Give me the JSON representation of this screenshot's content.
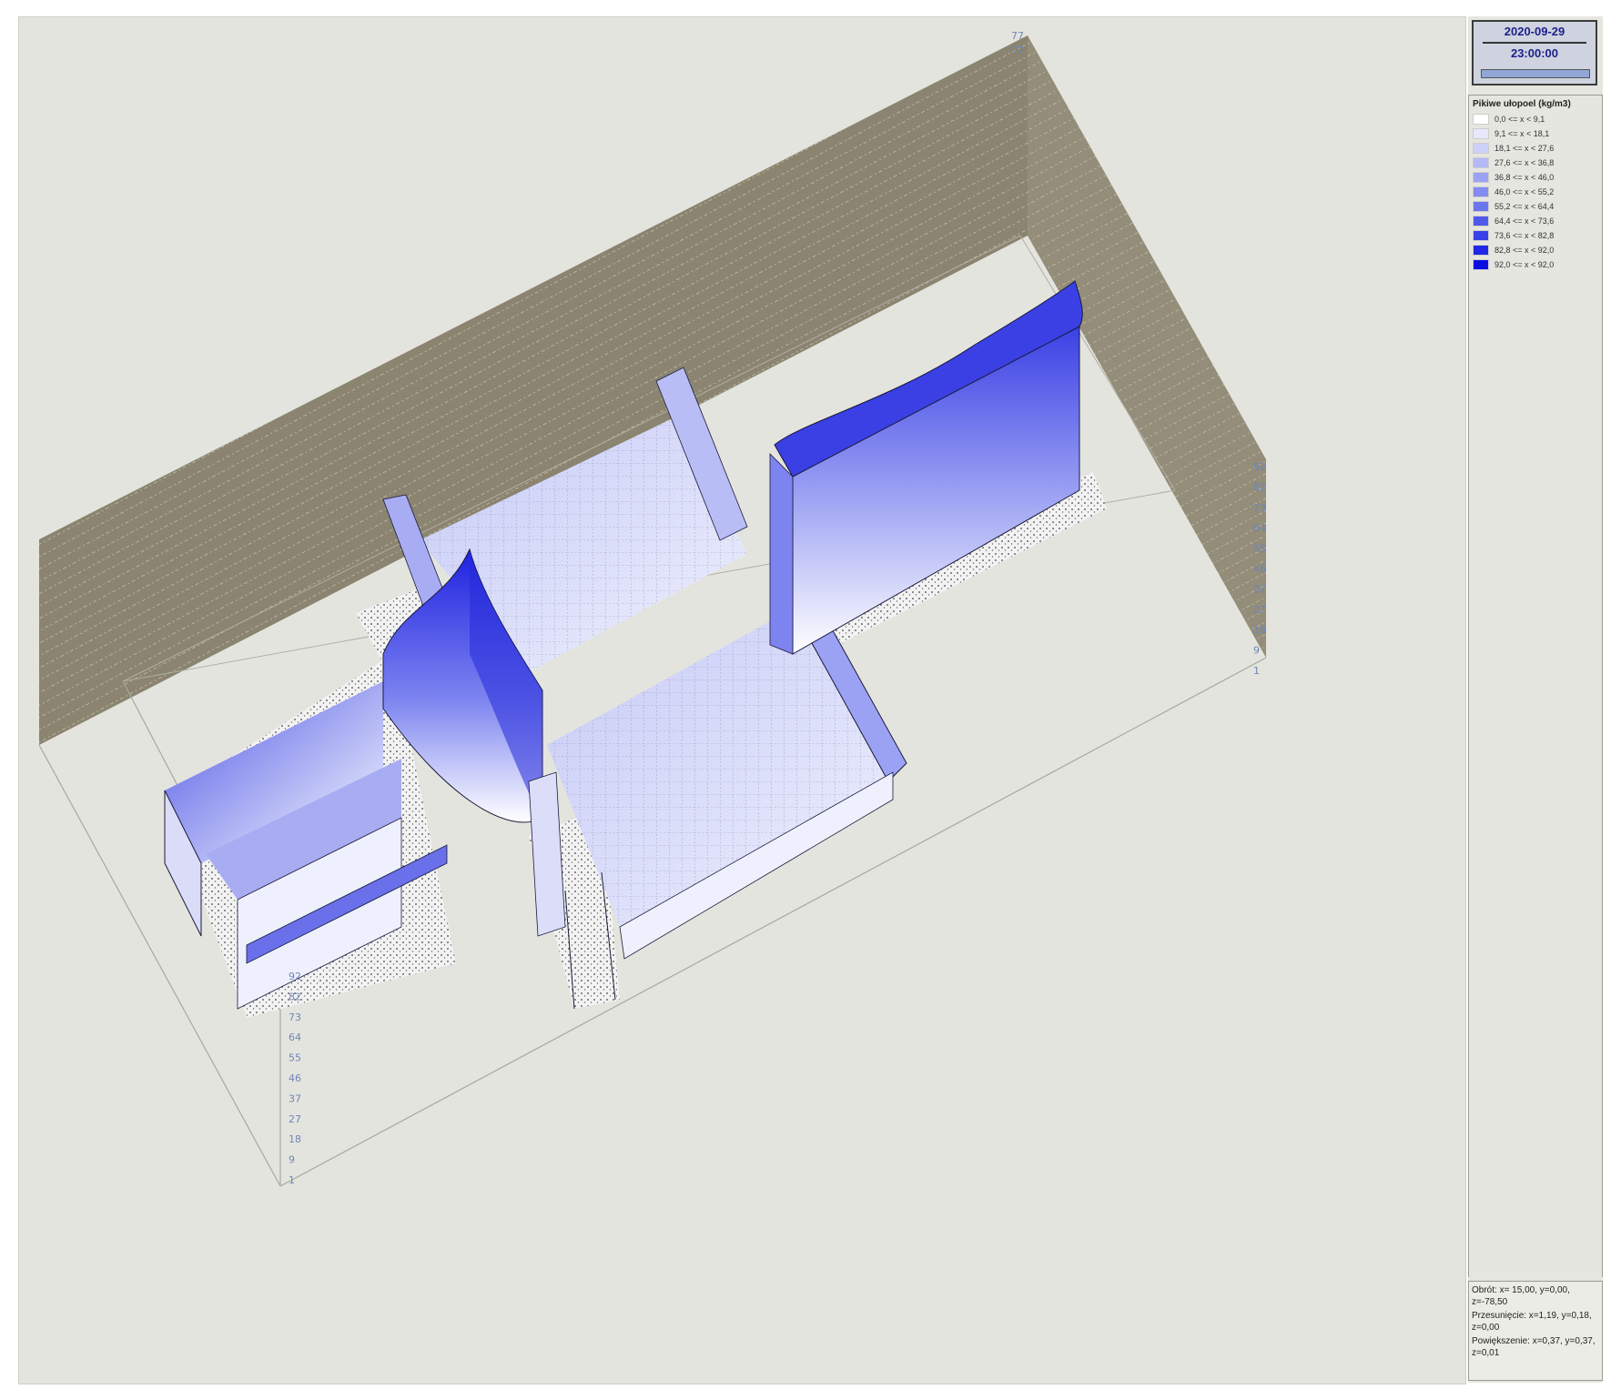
{
  "header": {
    "date": "2020-09-29",
    "time": "23:00:00",
    "progress": 1.0
  },
  "legend": {
    "title": "Pikiwe ułopoel (kg/m3)",
    "entries": [
      {
        "label": "0,0 <= x < 9,1",
        "color": "#ffffff"
      },
      {
        "label": "9,1 <= x < 18,1",
        "color": "#e6e8fb"
      },
      {
        "label": "18,1 <= x < 27,6",
        "color": "#cdd1f8"
      },
      {
        "label": "27,6 <= x < 36,8",
        "color": "#b4baf6"
      },
      {
        "label": "36,8 <= x < 46,0",
        "color": "#9ca2f3"
      },
      {
        "label": "46,0 <= x < 55,2",
        "color": "#838cf0"
      },
      {
        "label": "55,2 <= x < 64,4",
        "color": "#6a74ed"
      },
      {
        "label": "64,4 <= x < 73,6",
        "color": "#5159eb"
      },
      {
        "label": "73,6 <= x < 82,8",
        "color": "#3840e8"
      },
      {
        "label": "82,8 <= x < 92,0",
        "color": "#1f26e5"
      },
      {
        "label": "92,0 <= x < 92,0",
        "color": "#0a0fe0"
      }
    ]
  },
  "axes": {
    "z_ticks": [
      "1",
      "9",
      "18",
      "27",
      "37",
      "46",
      "55",
      "64",
      "73",
      "82",
      "92"
    ],
    "top_ticks": [
      "77",
      "77"
    ]
  },
  "info": {
    "rotation": "Obrót: x= 15,00, y=0,00, z=-78,50",
    "translation": "Przesunięcie: x=1,19, y=0,18, z=0,00",
    "scale": "Powiększenie: x=0,37, y=0,37, z=0,01"
  },
  "colors": {
    "walls": "#8a8470",
    "surface_peak": "#1f22e0",
    "surface_low": "#ffffff",
    "background": "#e4e4de"
  }
}
